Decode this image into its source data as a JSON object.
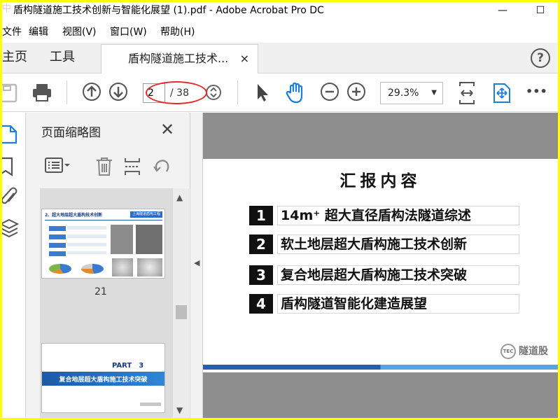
{
  "window": {
    "title": "盾构隧道施工技术创新与智能化展望 (1).pdf - Adobe Acrobat Pro DC",
    "watermark": "中",
    "min": "—",
    "max": "☐"
  },
  "menu": [
    "文件",
    "编辑",
    "视图(V)",
    "窗口(W)",
    "帮助(H)"
  ],
  "tabs": {
    "home": "主页",
    "tools": "工具",
    "doc": "盾构隧道施工技术...",
    "close": "×",
    "help": "?"
  },
  "toolbar": {
    "page_current": "2",
    "page_total": "/ 38",
    "zoom": "29.3%",
    "more": "•••"
  },
  "panel": {
    "title": "页面缩略图",
    "thumb1_header": "2、超大地层超大盾构技术创新",
    "thumb1_tag": "上海隧道盾构工程",
    "thumb1_page": "21",
    "thumb2_part": "PART　3",
    "thumb2_title": "复合地层超大盾构施工技术突破"
  },
  "slide": {
    "title": "汇报内容",
    "items": [
      {
        "num": "1",
        "text": "14m⁺ 超大直径盾构法隧道综述"
      },
      {
        "num": "2",
        "text": "软土地层超大盾构施工技术创新"
      },
      {
        "num": "3",
        "text": "复合地层超大盾构施工技术突破"
      },
      {
        "num": "4",
        "text": "盾构隧道智能化建造展望"
      }
    ],
    "logo": "隧道股",
    "logo_badge": "TEC"
  },
  "colors": {
    "accent_blue": "#1c7fd6",
    "highlight_red": "#e42a2a",
    "band_dark": "#2a5ea8",
    "band_light": "#5aa3e0"
  }
}
